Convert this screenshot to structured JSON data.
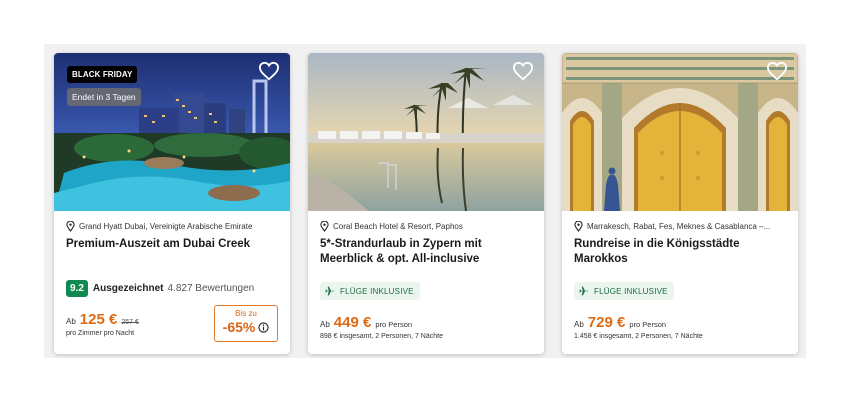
{
  "colors": {
    "accent_orange": "#e06a12",
    "rating_green": "#0f8a4f",
    "flights_bg": "#eaf5ee",
    "flights_text": "#1f6b44"
  },
  "cards": [
    {
      "image_desc_icon": "hotel-photo",
      "badge_primary": "BLACK FRIDAY",
      "badge_secondary": "Endet in 3 Tagen",
      "location": "Grand Hyatt Dubai, Vereinigte Arabische Emirate",
      "title": "Premium-Auszeit am Dubai Creek",
      "rating": {
        "score": "9.2",
        "label": "Ausgezeichnet",
        "reviews": "4.827 Bewertungen"
      },
      "price": {
        "prefix": "Ab",
        "amount": "125 €",
        "old": "257 €",
        "sub": "pro Zimmer pro Nacht"
      },
      "discount": {
        "label": "Bis zu",
        "value": "-65%"
      }
    },
    {
      "location": "Coral Beach Hotel & Resort, Paphos",
      "title": "5*-Strandurlaub in Zypern mit Meerblick & opt. All-inclusive",
      "flights": "FLÜGE INKLUSIVE",
      "price": {
        "prefix": "Ab",
        "amount": "449 €",
        "per": "pro Person",
        "sub": "898 € insgesamt, 2 Personen, 7 Nächte"
      }
    },
    {
      "location": "Marrakesch, Rabat, Fes, Meknes & Casablanca –...",
      "title": "Rundreise in die Königsstädte Marokkos",
      "flights": "FLÜGE INKLUSIVE",
      "price": {
        "prefix": "Ab",
        "amount": "729 €",
        "per": "pro Person",
        "sub": "1.458 € insgesamt, 2 Personen, 7 Nächte"
      }
    }
  ]
}
